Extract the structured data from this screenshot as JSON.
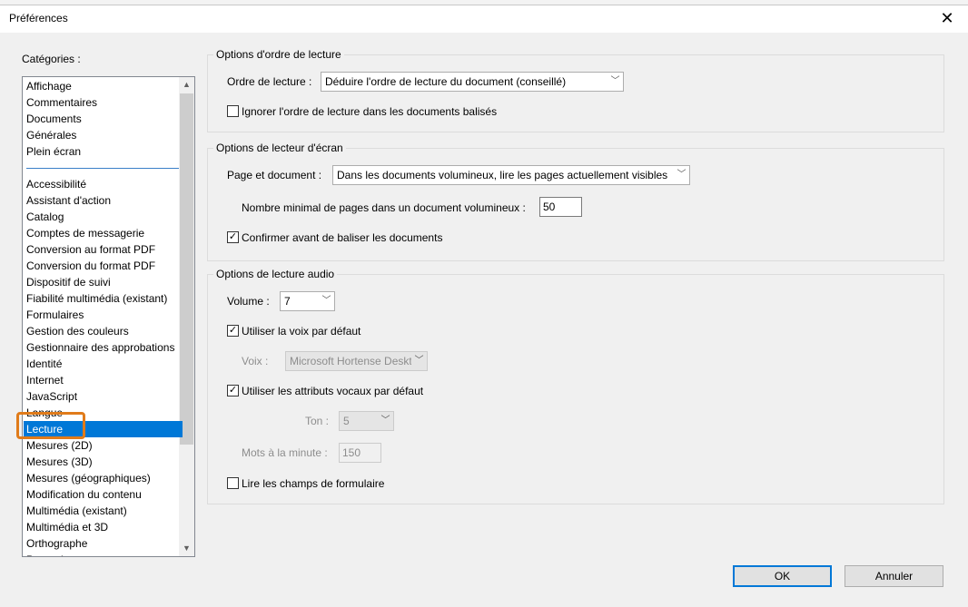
{
  "dialog": {
    "title": "Préférences",
    "close_glyph": "✕"
  },
  "categories": {
    "label": "Catégories :",
    "group1": [
      "Affichage",
      "Commentaires",
      "Documents",
      "Générales",
      "Plein écran"
    ],
    "group2": [
      "Accessibilité",
      "Assistant d'action",
      "Catalog",
      "Comptes de messagerie",
      "Conversion au format PDF",
      "Conversion du format PDF",
      "Dispositif de suivi",
      "Fiabilité multimédia (existant)",
      "Formulaires",
      "Gestion des couleurs",
      "Gestionnaire des approbations",
      "Identité",
      "Internet",
      "JavaScript",
      "Langue",
      "Lecture",
      "Mesures (2D)",
      "Mesures (3D)",
      "Mesures (géographiques)",
      "Modification du contenu",
      "Multimédia (existant)",
      "Multimédia et 3D",
      "Orthographe",
      "Protection"
    ],
    "selected": "Lecture"
  },
  "reading_order": {
    "legend": "Options d'ordre de lecture",
    "order_label": "Ordre de lecture :",
    "order_value": "Déduire l'ordre de lecture du document (conseillé)",
    "ignore_label": "Ignorer l'ordre de lecture dans les documents balisés",
    "ignore_checked": false
  },
  "screen_reader": {
    "legend": "Options de lecteur d'écran",
    "page_label": "Page et document :",
    "page_value": "Dans les documents volumineux, lire les pages actuellement visibles",
    "min_pages_label": "Nombre minimal de pages dans un document volumineux :",
    "min_pages_value": "50",
    "confirm_label": "Confirmer avant de baliser les documents",
    "confirm_checked": true
  },
  "audio": {
    "legend": "Options de lecture audio",
    "volume_label": "Volume :",
    "volume_value": "7",
    "default_voice_label": "Utiliser la voix par défaut",
    "default_voice_checked": true,
    "voice_label": "Voix :",
    "voice_value": "Microsoft Hortense Desktop",
    "default_attrs_label": "Utiliser les attributs vocaux par défaut",
    "default_attrs_checked": true,
    "tone_label": "Ton :",
    "tone_value": "5",
    "wpm_label": "Mots à la minute :",
    "wpm_value": "150",
    "form_fields_label": "Lire les champs de formulaire",
    "form_fields_checked": false
  },
  "buttons": {
    "ok": "OK",
    "cancel": "Annuler"
  },
  "colors": {
    "selection": "#0078d7",
    "highlight_box": "#e07b1a"
  }
}
